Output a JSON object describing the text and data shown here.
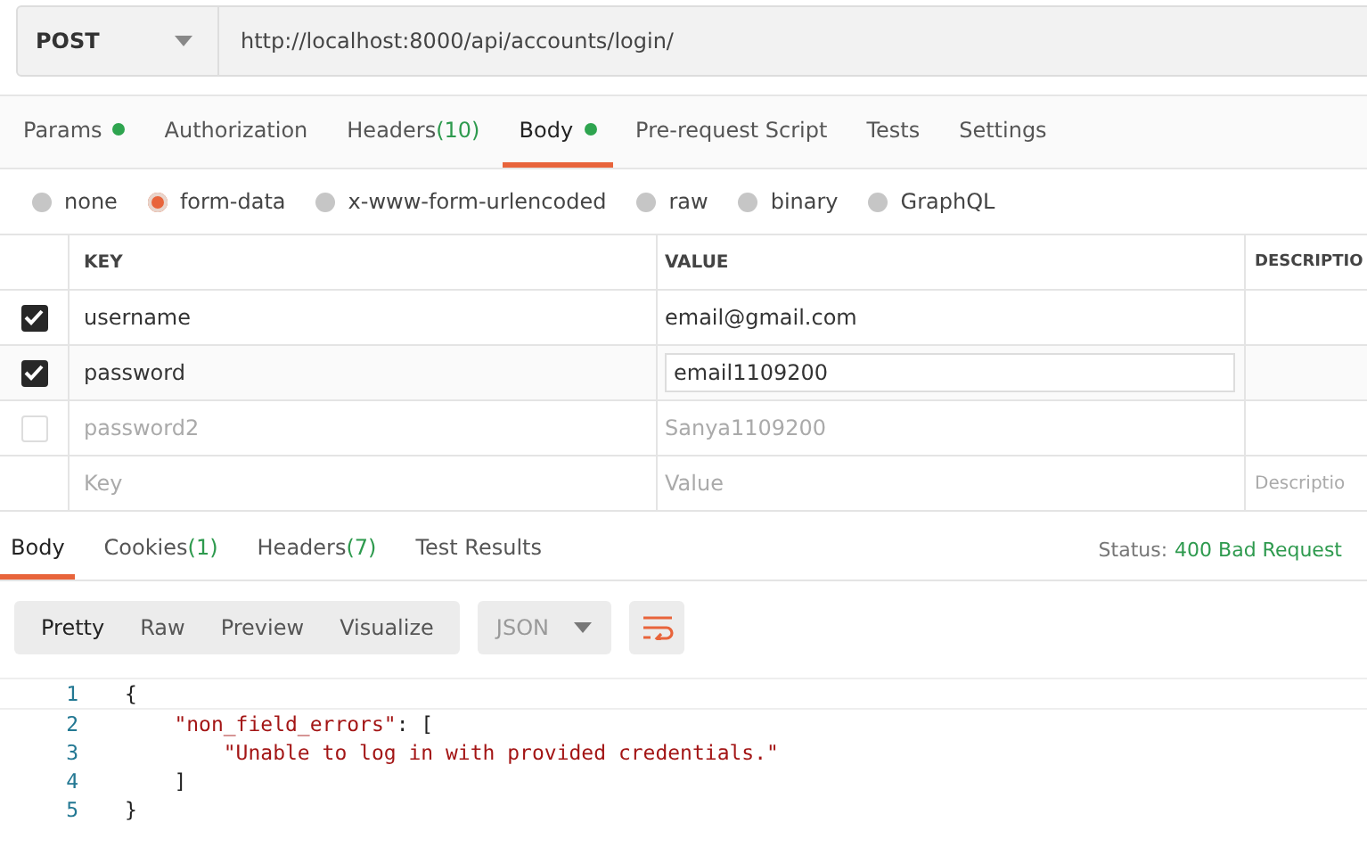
{
  "request": {
    "method": "POST",
    "url": "http://localhost:8000/api/accounts/login/"
  },
  "request_tabs": [
    {
      "label": "Params",
      "dot": true,
      "selected": false
    },
    {
      "label": "Authorization",
      "dot": false,
      "selected": false
    },
    {
      "label": "Headers",
      "count": "(10)",
      "dot": false,
      "selected": false
    },
    {
      "label": "Body",
      "dot": true,
      "selected": true
    },
    {
      "label": "Pre-request Script",
      "dot": false,
      "selected": false
    },
    {
      "label": "Tests",
      "dot": false,
      "selected": false
    },
    {
      "label": "Settings",
      "dot": false,
      "selected": false
    }
  ],
  "body_types": [
    {
      "label": "none",
      "selected": false
    },
    {
      "label": "form-data",
      "selected": true
    },
    {
      "label": "x-www-form-urlencoded",
      "selected": false
    },
    {
      "label": "raw",
      "selected": false
    },
    {
      "label": "binary",
      "selected": false
    },
    {
      "label": "GraphQL",
      "selected": false
    }
  ],
  "params_table": {
    "columns": [
      "KEY",
      "VALUE",
      "DESCRIPTIO"
    ],
    "rows": [
      {
        "kind": "entry",
        "checked": true,
        "key": "username",
        "value": "email@gmail.com",
        "editing": false
      },
      {
        "kind": "entry",
        "checked": true,
        "key": "password",
        "value": "email1109200",
        "editing": true
      },
      {
        "kind": "entry",
        "checked": false,
        "key": "password2",
        "value": "Sanya1109200",
        "editing": false
      },
      {
        "kind": "new",
        "key": "Key",
        "value": "Value",
        "description": "Descriptio"
      }
    ]
  },
  "response": {
    "tabs": [
      {
        "label": "Body",
        "selected": true
      },
      {
        "label": "Cookies",
        "count": "(1)",
        "selected": false
      },
      {
        "label": "Headers",
        "count": "(7)",
        "selected": false
      },
      {
        "label": "Test Results",
        "selected": false
      }
    ],
    "status_label": "Status:",
    "status": "400 Bad Request",
    "view_tabs": [
      {
        "label": "Pretty",
        "selected": true
      },
      {
        "label": "Raw",
        "selected": false
      },
      {
        "label": "Preview",
        "selected": false
      },
      {
        "label": "Visualize",
        "selected": false
      }
    ],
    "format": "JSON",
    "code_lines": [
      {
        "number": "1",
        "segments": [
          {
            "kind": "punct",
            "text": "{"
          }
        ]
      },
      {
        "number": "2",
        "segments": [
          {
            "kind": "string",
            "text": "    \"non_field_errors\""
          },
          {
            "kind": "punct",
            "text": ": ["
          }
        ]
      },
      {
        "number": "3",
        "segments": [
          {
            "kind": "string",
            "text": "        \"Unable to log in with provided credentials.\""
          }
        ]
      },
      {
        "number": "4",
        "segments": [
          {
            "kind": "punct",
            "text": "    ]"
          }
        ]
      },
      {
        "number": "5",
        "segments": [
          {
            "kind": "punct",
            "text": "}"
          }
        ]
      }
    ]
  }
}
